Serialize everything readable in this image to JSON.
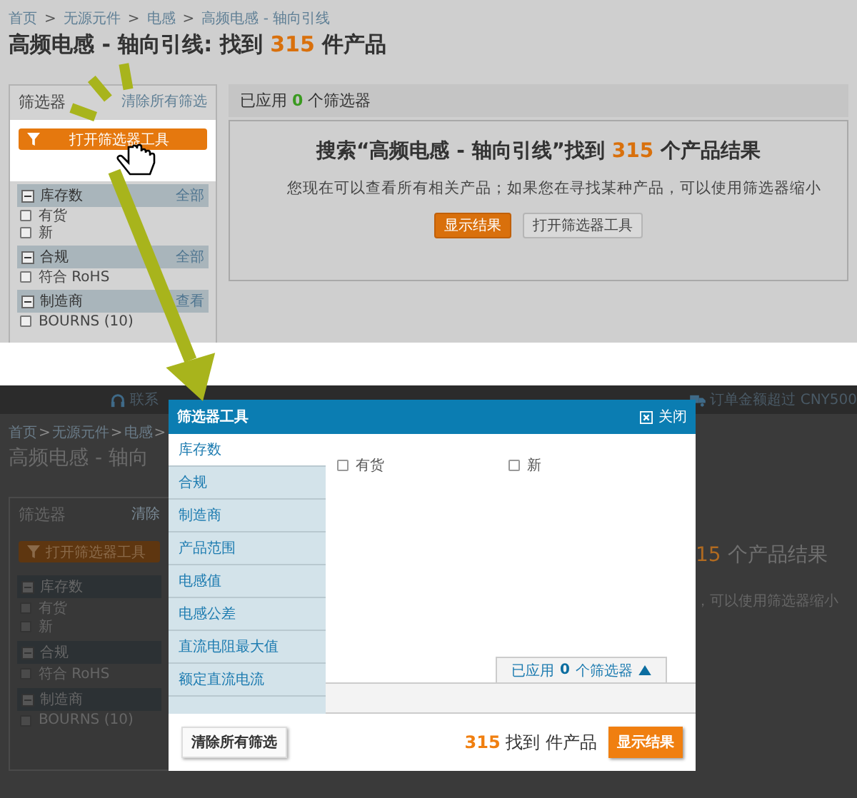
{
  "before_screen": {
    "breadcrumb": [
      {
        "label": "首页",
        "kind": "link"
      },
      {
        "label": ">",
        "kind": "separator"
      },
      {
        "label": "无源元件",
        "kind": "link"
      },
      {
        "label": ">",
        "kind": "separator"
      },
      {
        "label": "电感",
        "kind": "link"
      },
      {
        "label": ">",
        "kind": "separator"
      },
      {
        "label": "高频电感 - 轴向引线",
        "kind": "link"
      }
    ],
    "title": {
      "text": "高频电感 - 轴向引线: 找到",
      "count": "315",
      "suffix": "件产品"
    },
    "filter_panel": {
      "title": "筛选器",
      "clear_link": "清除所有筛选",
      "open_button": "打开筛选器工具",
      "groups": [
        {
          "name": "库存数",
          "action": "全部",
          "expanded": true,
          "options": [
            {
              "label": "有货",
              "checked": false
            },
            {
              "label": "新",
              "checked": false
            }
          ]
        },
        {
          "name": "合规",
          "action": "全部",
          "expanded": true,
          "options": [
            {
              "label": "符合 RoHS",
              "checked": false
            }
          ]
        },
        {
          "name": "制造商",
          "action": "查看",
          "expanded": true,
          "options": [
            {
              "label": "BOURNS (10)",
              "checked": false
            }
          ]
        }
      ]
    },
    "results_panel": {
      "applied": {
        "prefix": "已应用",
        "count": "0",
        "suffix": "个筛选器"
      },
      "heading": {
        "prefix": "搜索“高频电感 - 轴向引线”找到",
        "count": "315",
        "suffix": "个产品结果"
      },
      "message": "您现在可以查看所有相关产品；如果您在寻找某种产品，可以使用筛选器缩小",
      "buttons": [
        {
          "label": "显示结果",
          "kind": "primary"
        },
        {
          "label": "打开筛选器工具",
          "kind": "secondary"
        }
      ]
    }
  },
  "after_screen": {
    "top_bar": {
      "contact": "联系",
      "notice": "订单金额超过 CNY500"
    },
    "breadcrumb": [
      {
        "label": "首页",
        "kind": "link"
      },
      {
        "label": ">",
        "kind": "separator"
      },
      {
        "label": "无源元件",
        "kind": "link"
      },
      {
        "label": ">",
        "kind": "separator"
      },
      {
        "label": "电感",
        "kind": "link"
      },
      {
        "label": ">",
        "kind": "separator"
      }
    ],
    "title": {
      "text": "高频电感 - 轴向"
    },
    "filter_panel": {
      "title": "筛选器",
      "clear_link": "清除",
      "open_button": "打开筛选器工具",
      "groups": [
        {
          "name": "库存数",
          "expanded": true,
          "options": [
            {
              "label": "有货",
              "checked": false
            },
            {
              "label": "新",
              "checked": false
            }
          ]
        },
        {
          "name": "合规",
          "expanded": true,
          "options": [
            {
              "label": "符合 RoHS",
              "checked": false
            }
          ]
        },
        {
          "name": "制造商",
          "expanded": true,
          "options": [
            {
              "label": "BOURNS (10)",
              "checked": false
            }
          ]
        }
      ]
    },
    "results_heading": {
      "count": "15",
      "suffix": "个产品结果"
    },
    "message": "，可以使用筛选器缩小"
  },
  "filter_tool_dialog": {
    "title": "筛选器工具",
    "close": "关闭",
    "categories": [
      {
        "label": "库存数",
        "selected": true
      },
      {
        "label": "合规",
        "selected": false
      },
      {
        "label": "制造商",
        "selected": false
      },
      {
        "label": "产品范围",
        "selected": false
      },
      {
        "label": "电感值",
        "selected": false
      },
      {
        "label": "电感公差",
        "selected": false
      },
      {
        "label": "直流电阻最大值",
        "selected": false
      },
      {
        "label": "额定直流电流",
        "selected": false
      }
    ],
    "options": [
      {
        "label": "有货",
        "checked": false
      },
      {
        "label": "新",
        "checked": false
      }
    ],
    "applied_tab": {
      "prefix": "已应用",
      "count": "0",
      "suffix": "个筛选器"
    },
    "clear_button": "清除所有筛选",
    "found": {
      "count": "315",
      "text": "找到 件产品"
    },
    "show_button": "显示结果"
  }
}
